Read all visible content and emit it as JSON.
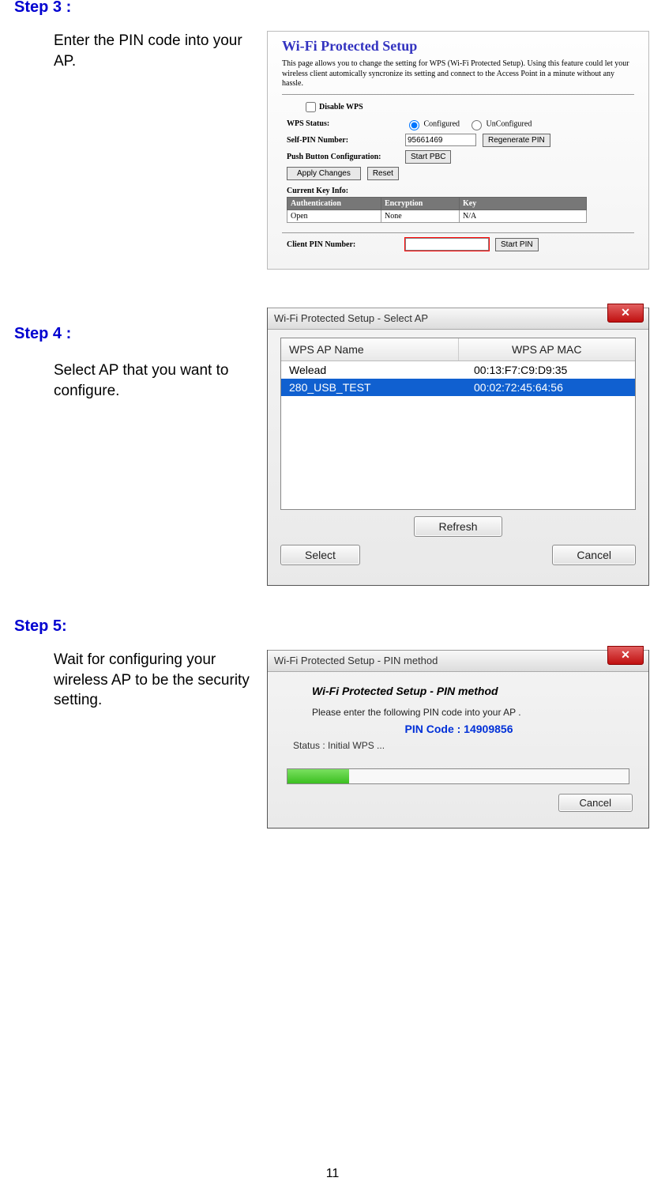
{
  "page_number": "11",
  "step3": {
    "label": "Step 3 :",
    "text": "Enter the PIN code into your AP.",
    "shot": {
      "title": "Wi-Fi Protected Setup",
      "desc": "This page allows you to change the setting for WPS (Wi-Fi Protected Setup). Using this feature could let your wireless client automically syncronize its setting and connect to the Access Point in a minute without any hassle.",
      "disable_label": "Disable WPS",
      "rows": {
        "status_lbl": "WPS Status:",
        "status_opt1": "Configured",
        "status_opt2": "UnConfigured",
        "selfpin_lbl": "Self-PIN Number:",
        "selfpin_val": "95661469",
        "regen_btn": "Regenerate PIN",
        "pbc_lbl": "Push Button Configuration:",
        "pbc_btn": "Start PBC",
        "apply_btn": "Apply Changes",
        "reset_btn": "Reset",
        "cki_lbl": "Current Key Info:",
        "th1": "Authentication",
        "th2": "Encryption",
        "th3": "Key",
        "td1": "Open",
        "td2": "None",
        "td3": "N/A",
        "client_lbl": "Client PIN Number:",
        "client_val": "",
        "startpin_btn": "Start PIN"
      }
    }
  },
  "step4": {
    "label": "Step 4 :",
    "text": "Select AP that you want to configure.",
    "shot": {
      "title": "Wi-Fi Protected Setup - Select AP",
      "col1": "WPS AP Name",
      "col2": "WPS AP MAC",
      "rows": [
        {
          "name": "Welead",
          "mac": "00:13:F7:C9:D9:35",
          "selected": false
        },
        {
          "name": "280_USB_TEST",
          "mac": "00:02:72:45:64:56",
          "selected": true
        }
      ],
      "refresh": "Refresh",
      "select": "Select",
      "cancel": "Cancel"
    }
  },
  "step5": {
    "label": "Step 5:",
    "text": "Wait for configuring your wireless AP to be the security setting.",
    "shot": {
      "title": "Wi-Fi Protected Setup - PIN method",
      "heading": "Wi-Fi Protected Setup - PIN method",
      "prompt": "Please enter the following PIN code into your AP .",
      "pin_label": "PIN Code :  14909856",
      "status": "Status : Initial WPS ...",
      "cancel": "Cancel"
    }
  }
}
